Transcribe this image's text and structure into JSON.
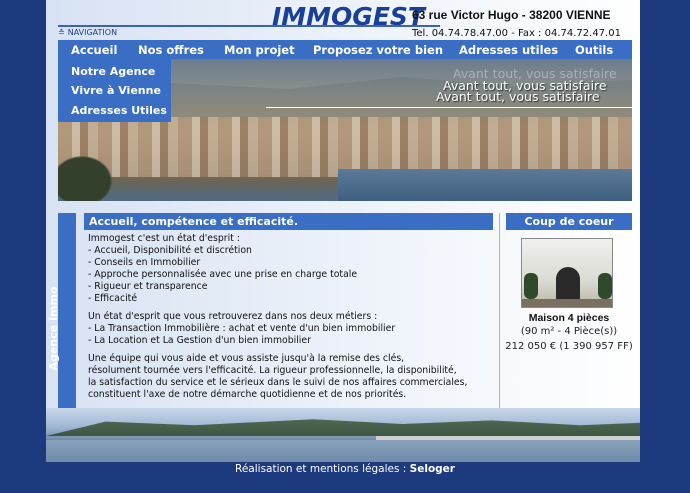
{
  "header": {
    "logo": "IMMOGEST",
    "address": "63 rue Victor Hugo - 38200 VIENNE",
    "nav_label": "NAVIGATION",
    "phone_fax": "Tel. 04.74.78.47.00 - Fax : 04.74.72.47.01"
  },
  "menu": {
    "items": [
      {
        "label": "Accueil"
      },
      {
        "label": "Nos offres"
      },
      {
        "label": "Mon projet"
      },
      {
        "label": "Proposez votre bien"
      },
      {
        "label": "Adresses utiles"
      },
      {
        "label": "Outils"
      }
    ],
    "dropdown": [
      {
        "label": "Notre Agence"
      },
      {
        "label": "Vivre à Vienne"
      },
      {
        "label": "Adresses Utiles"
      }
    ]
  },
  "banner": {
    "slogan": "Avant tout, vous satisfaire"
  },
  "side_tab": "Agence Immo",
  "content": {
    "title": "Accueil, compétence et efficacité.",
    "intro": "Immogest c'est un état d'esprit :",
    "points": [
      "- Accueil, Disponibilité et discrétion",
      "- Conseils en Immobilier",
      "- Approche personnalisée avec une prise en charge totale",
      "- Rigueur et transparence",
      "- Efficacité"
    ],
    "metiers_intro": "Un état d'esprit que vous retrouverez dans nos deux métiers :",
    "metiers": [
      "- La Transaction Immobilière : achat et vente d'un bien immobilier",
      "- La Location et La Gestion d'un bien immobilier"
    ],
    "closing": [
      "Une équipe qui vous aide et vous assiste jusqu'à la remise des clés,",
      "résolument tournée vers l'efficacité. La rigueur professionnelle, la disponibilité,",
      "la satisfaction du service et le sérieux dans le suivi de nos affaires commerciales,",
      "constituent l'axe de notre démarche quotidienne et de nos priorités."
    ]
  },
  "coup_de_coeur": {
    "title": "Coup de coeur",
    "name": "Maison 4 pièces",
    "description": "(90 m² - 4 Pièce(s))",
    "price": "212 050 € (1 390 957 FF)"
  },
  "footer": {
    "text": "Réalisation et mentions légales :",
    "link": "Seloger"
  }
}
